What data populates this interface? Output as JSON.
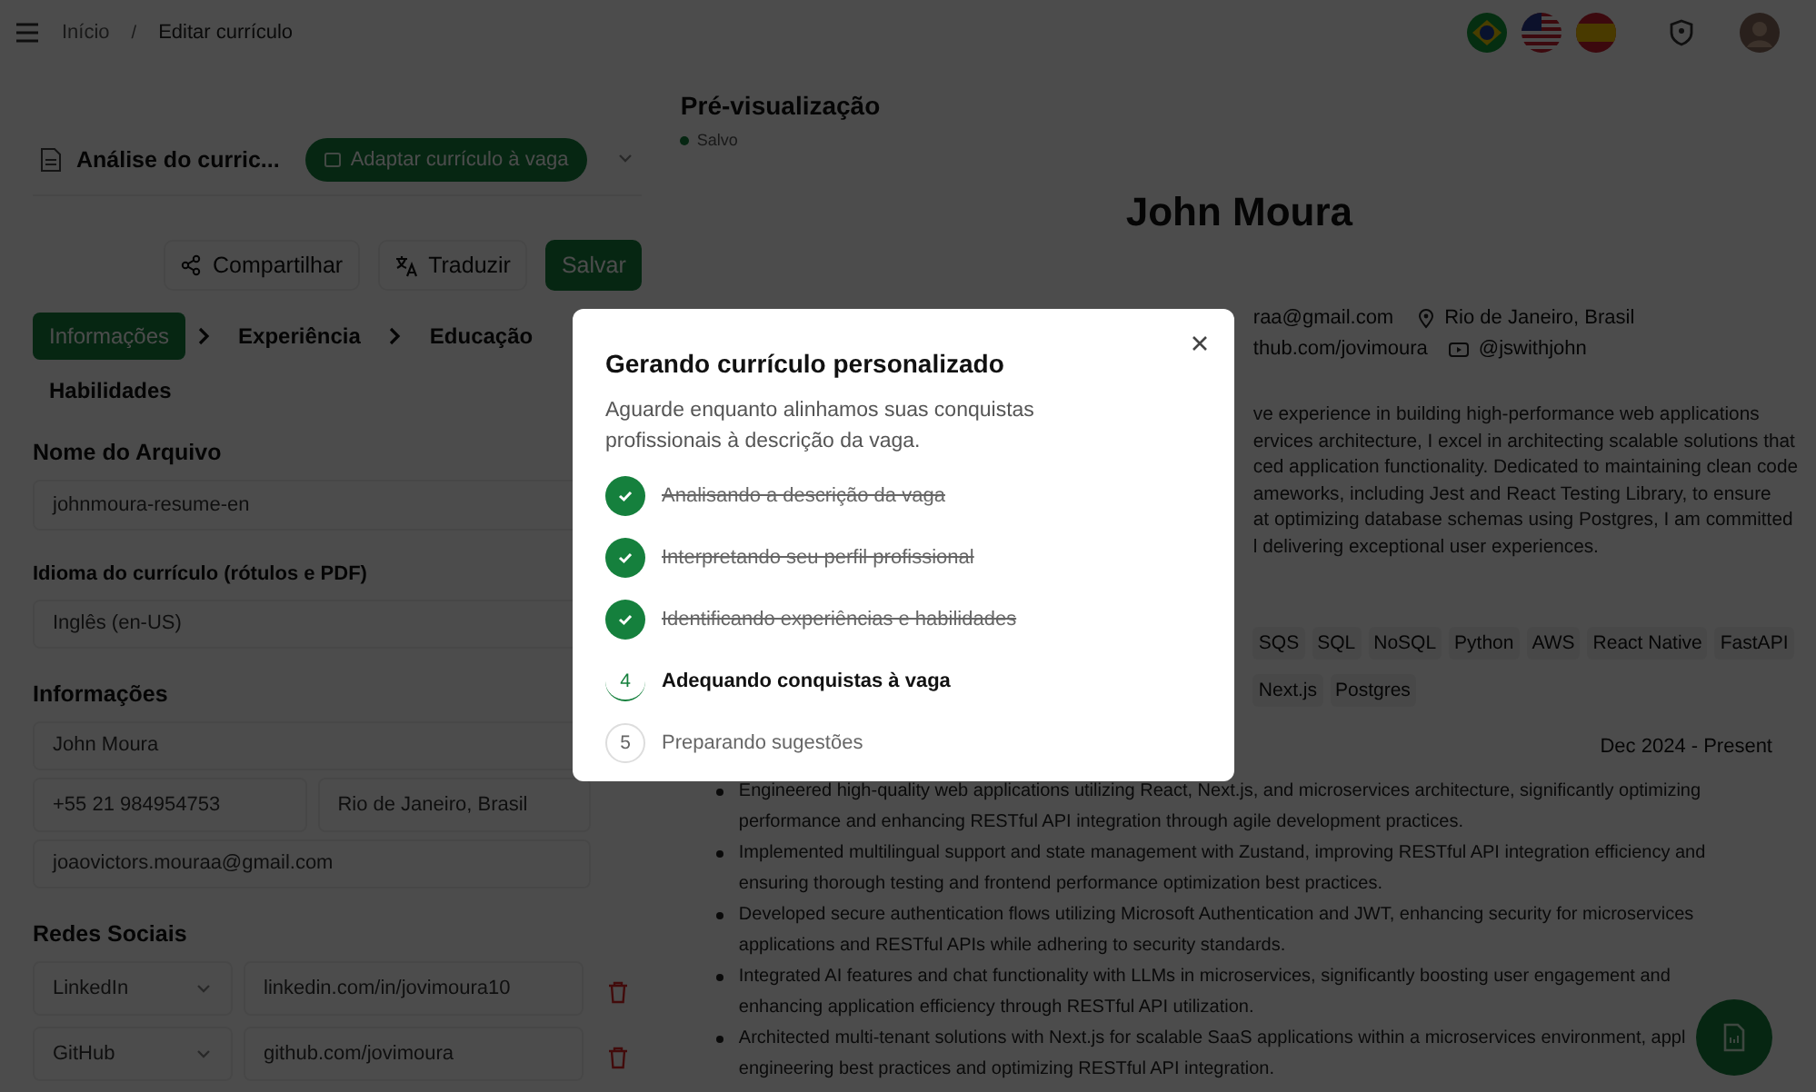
{
  "breadcrumb": [
    "Início",
    "Editar currículo"
  ],
  "breadcrumb_separator": "/",
  "top_icons": [
    {
      "kind": "flag-br"
    },
    {
      "kind": "flag-us"
    },
    {
      "kind": "flag-es"
    },
    {
      "kind": "shield"
    },
    {
      "kind": "avatar"
    }
  ],
  "analysis": {
    "title": "Análise do curric...",
    "adapt_button": "Adaptar currículo à vaga"
  },
  "actions": [
    {
      "label": "Compartilhar",
      "kind": "share"
    },
    {
      "label": "Traduzir",
      "kind": "translate"
    },
    {
      "label": "Salvar",
      "kind": "primary"
    }
  ],
  "tabs": [
    {
      "label": "Informações",
      "selected": true
    },
    {
      "label": "Experiência",
      "selected": false
    },
    {
      "label": "Educação",
      "selected": false
    },
    {
      "label": "Habilidades",
      "selected": false
    }
  ],
  "form": {
    "file_name_label": "Nome do Arquivo",
    "file_name": "johnmoura-resume-en",
    "language_label": "Idioma do currículo (rótulos e PDF)",
    "language": "Inglês (en-US)",
    "info_heading": "Informações",
    "name": "John Moura",
    "phone": "+55 21 984954753",
    "location": "Rio de Janeiro, Brasil",
    "email": "joaovictors.mouraa@gmail.com",
    "social_heading": "Redes Sociais",
    "socials": [
      {
        "network": "LinkedIn",
        "url": "linkedin.com/in/jovimoura10"
      },
      {
        "network": "GitHub",
        "url": "github.com/jovimoura"
      }
    ]
  },
  "preview": {
    "title": "Pré-visualização",
    "status": "Salvo",
    "name": "John Moura",
    "contacts": [
      [
        {
          "kind": "email",
          "text": "raa@gmail.com"
        },
        {
          "kind": "location",
          "text": "Rio de Janeiro, Brasil"
        }
      ],
      [
        {
          "kind": "github",
          "text": "thub.com/jovimoura"
        },
        {
          "kind": "youtube",
          "text": "@jswithjohn"
        }
      ]
    ],
    "summary_lines": [
      "ve experience in building high-performance web applications",
      "ervices architecture, I excel in architecting scalable solutions that",
      "ced application functionality. Dedicated to maintaining clean code",
      "ameworks, including Jest and React Testing Library, to ensure",
      "at optimizing database schemas using Postgres, I am committed",
      "l delivering exceptional user experiences."
    ],
    "skills": [
      [
        "SQS",
        "SQL",
        "NoSQL",
        "Python",
        "AWS",
        "React Native",
        "FastAPI"
      ],
      [
        "Next.js",
        "Postgres"
      ]
    ],
    "date": "Dec 2024 - Present",
    "bullets": [
      [
        "Engineered high-quality web applications utilizing React, Next.js, and microservices architecture, significantly optimizing",
        "performance and enhancing RESTful API integration through agile development practices."
      ],
      [
        "Implemented multilingual support and state management with Zustand, improving RESTful API integration efficiency and",
        "ensuring thorough testing and frontend performance optimization best practices."
      ],
      [
        "Developed secure authentication flows utilizing Microsoft Authentication and JWT, enhancing security for microservices",
        "applications and RESTful APIs while adhering to security standards."
      ],
      [
        "Integrated AI features and chat functionality with LLMs in microservices, significantly boosting user engagement and",
        "enhancing application efficiency through RESTful API utilization."
      ],
      [
        "Architected multi-tenant solutions with Next.js for scalable SaaS applications within a microservices environment, appl",
        "engineering best practices and optimizing RESTful API integration."
      ]
    ]
  },
  "modal": {
    "title": "Gerando currículo personalizado",
    "description": "Aguarde enquanto alinhamos suas conquistas profissionais à descrição da vaga.",
    "steps": [
      {
        "label": "Analisando a descrição da vaga",
        "kind": "done"
      },
      {
        "label": "Interpretando seu perfil profissional",
        "kind": "done"
      },
      {
        "label": "Identificando experiências e habilidades",
        "kind": "done"
      },
      {
        "number": "4",
        "label": "Adequando conquistas à vaga",
        "kind": "active"
      },
      {
        "number": "5",
        "label": "Preparando sugestões",
        "kind": "pending"
      }
    ]
  }
}
